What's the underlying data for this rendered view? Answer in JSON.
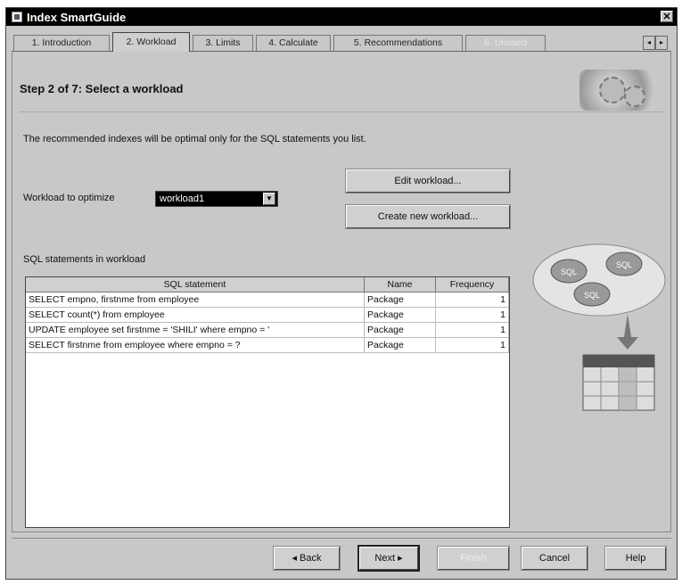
{
  "window": {
    "title": "Index SmartGuide",
    "close_glyph": "✕"
  },
  "tabs": [
    {
      "label": "1. Introduction",
      "state": "normal"
    },
    {
      "label": "2. Workload",
      "state": "active"
    },
    {
      "label": "3. Limits",
      "state": "normal"
    },
    {
      "label": "4. Calculate",
      "state": "normal"
    },
    {
      "label": "5. Recommendations",
      "state": "normal"
    },
    {
      "label": "6. Unused",
      "state": "disabled"
    }
  ],
  "tab_scroll": {
    "left": "◂",
    "right": "▸"
  },
  "step": {
    "title": "Step 2 of 7: Select a workload"
  },
  "description": "The recommended indexes will be optimal only for the SQL statements you list.",
  "workload": {
    "label": "Workload to optimize",
    "selected": "workload1",
    "arrow": "▼"
  },
  "buttons": {
    "edit": "Edit workload...",
    "create": "Create new workload..."
  },
  "statements": {
    "label": "SQL statements in workload",
    "columns": [
      "SQL statement",
      "Name",
      "Frequency"
    ],
    "rows": [
      [
        "SELECT empno, firstnme from employee",
        "Package",
        "1"
      ],
      [
        "SELECT count(*)  from employee",
        "Package",
        "1"
      ],
      [
        "UPDATE employee set firstnme = 'SHILI' where empno = '",
        "Package",
        "1"
      ],
      [
        "SELECT firstnme from employee where empno = ?",
        "Package",
        "1"
      ]
    ]
  },
  "graphic": {
    "sql_labels": [
      "SQL",
      "SQL",
      "SQL"
    ],
    "icon": "sql-to-table-icon"
  },
  "footer": {
    "back": "◂ Back",
    "next": "Next ▸",
    "finish": "Finish",
    "cancel": "Cancel",
    "help": "Help"
  },
  "colors": {
    "window_bg": "#c8c8c8",
    "titlebar": "#000000",
    "select_bg": "#000000"
  }
}
